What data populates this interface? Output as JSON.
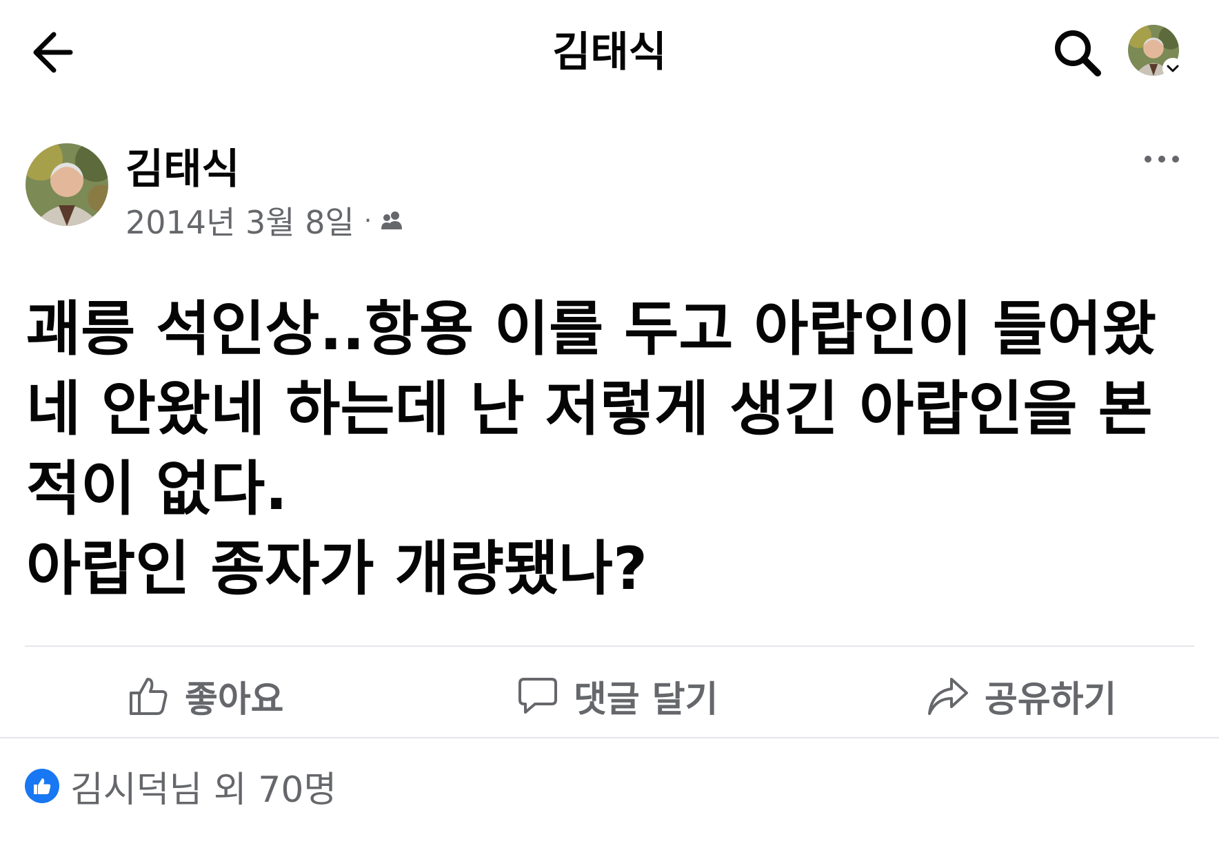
{
  "header": {
    "title": "김태식",
    "back_icon": "arrow-left-icon",
    "search_icon": "search-icon"
  },
  "post": {
    "author": "김태식",
    "date": "2014년 3월 8일",
    "audience_icon": "friends-icon",
    "body_lines": [
      "괘릉 석인상..항용 이를 두고 아랍인이 들어왔",
      "네 안왔네 하는데 난 저렇게 생긴 아랍인을 본",
      "적이 없다.",
      "아랍인 종자가 개량됐나?"
    ]
  },
  "actions": {
    "like": "좋아요",
    "comment": "댓글 달기",
    "share": "공유하기"
  },
  "reactions": {
    "text": "김시덕님 외 70명"
  },
  "colors": {
    "text_primary": "#050505",
    "text_secondary": "#65676b",
    "like_blue": "#1877f2",
    "divider": "#e4e6eb"
  }
}
